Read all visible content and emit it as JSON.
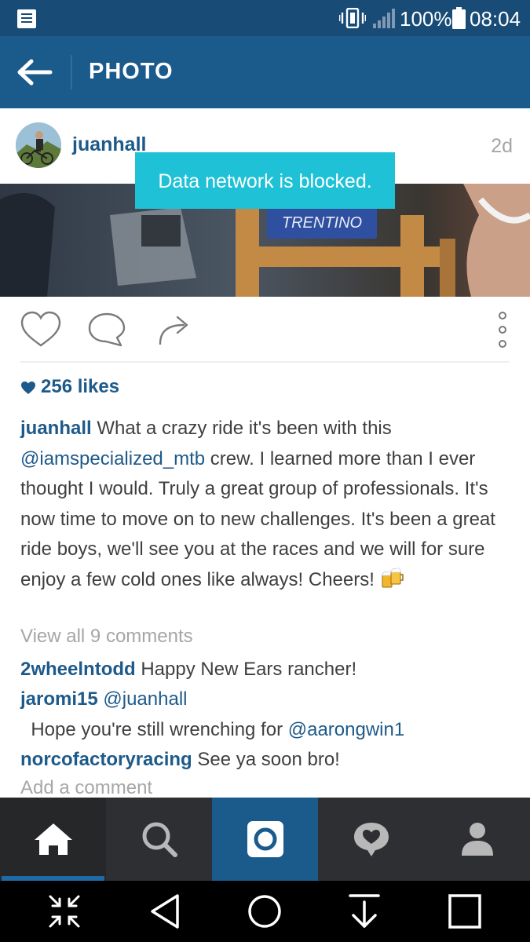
{
  "status_bar": {
    "battery_percent": "100%",
    "time": "08:04",
    "icons": [
      "notification-icon",
      "vibrate-icon",
      "signal-icon",
      "battery-icon"
    ]
  },
  "app_bar": {
    "title": "PHOTO",
    "back_icon": "arrow-back-icon"
  },
  "post": {
    "username": "juanhall",
    "timestamp": "2d",
    "photo_text": "TRENTINO",
    "likes": "256 likes",
    "caption": {
      "username": "juanhall",
      "text_before": " What a crazy ride it's been with this ",
      "mention": "@iamspecialized_mtb",
      "text_after": " crew. I learned more than I ever thought I would. Truly a great group of professionals. It's now time to move on to new challenges. It's been a great ride boys, we'll see you at the races and we will for sure enjoy a few cold ones like always! Cheers! ",
      "emoji": "beer-mugs-emoji"
    },
    "view_all_comments": "View all 9 comments",
    "comments": [
      {
        "username": "2wheelntodd",
        "text": " Happy New Ears rancher!"
      },
      {
        "username": "jaromi15",
        "mention": "@juanhall",
        "text": "  Hope you're still wrenching for ",
        "mention2": "@aarongwin1"
      },
      {
        "username": "norcofactoryracing",
        "text": " See ya soon bro!"
      }
    ],
    "add_comment_placeholder": "Add a comment"
  },
  "toast": {
    "message": "Data network is blocked."
  },
  "bottom_nav": {
    "tabs": [
      "home-icon",
      "search-icon",
      "camera-icon",
      "activity-icon",
      "profile-icon"
    ],
    "active": "home-icon"
  },
  "system_nav": {
    "buttons": [
      "shrink-icon",
      "back-triangle-icon",
      "home-circle-icon",
      "download-icon",
      "recents-square-icon"
    ]
  },
  "colors": {
    "status_bar": "#184b76",
    "app_bar": "#1b5b8c",
    "link": "#1d5a8a",
    "toast": "#1ec1d5",
    "bottom_nav": "#2e2f33"
  }
}
